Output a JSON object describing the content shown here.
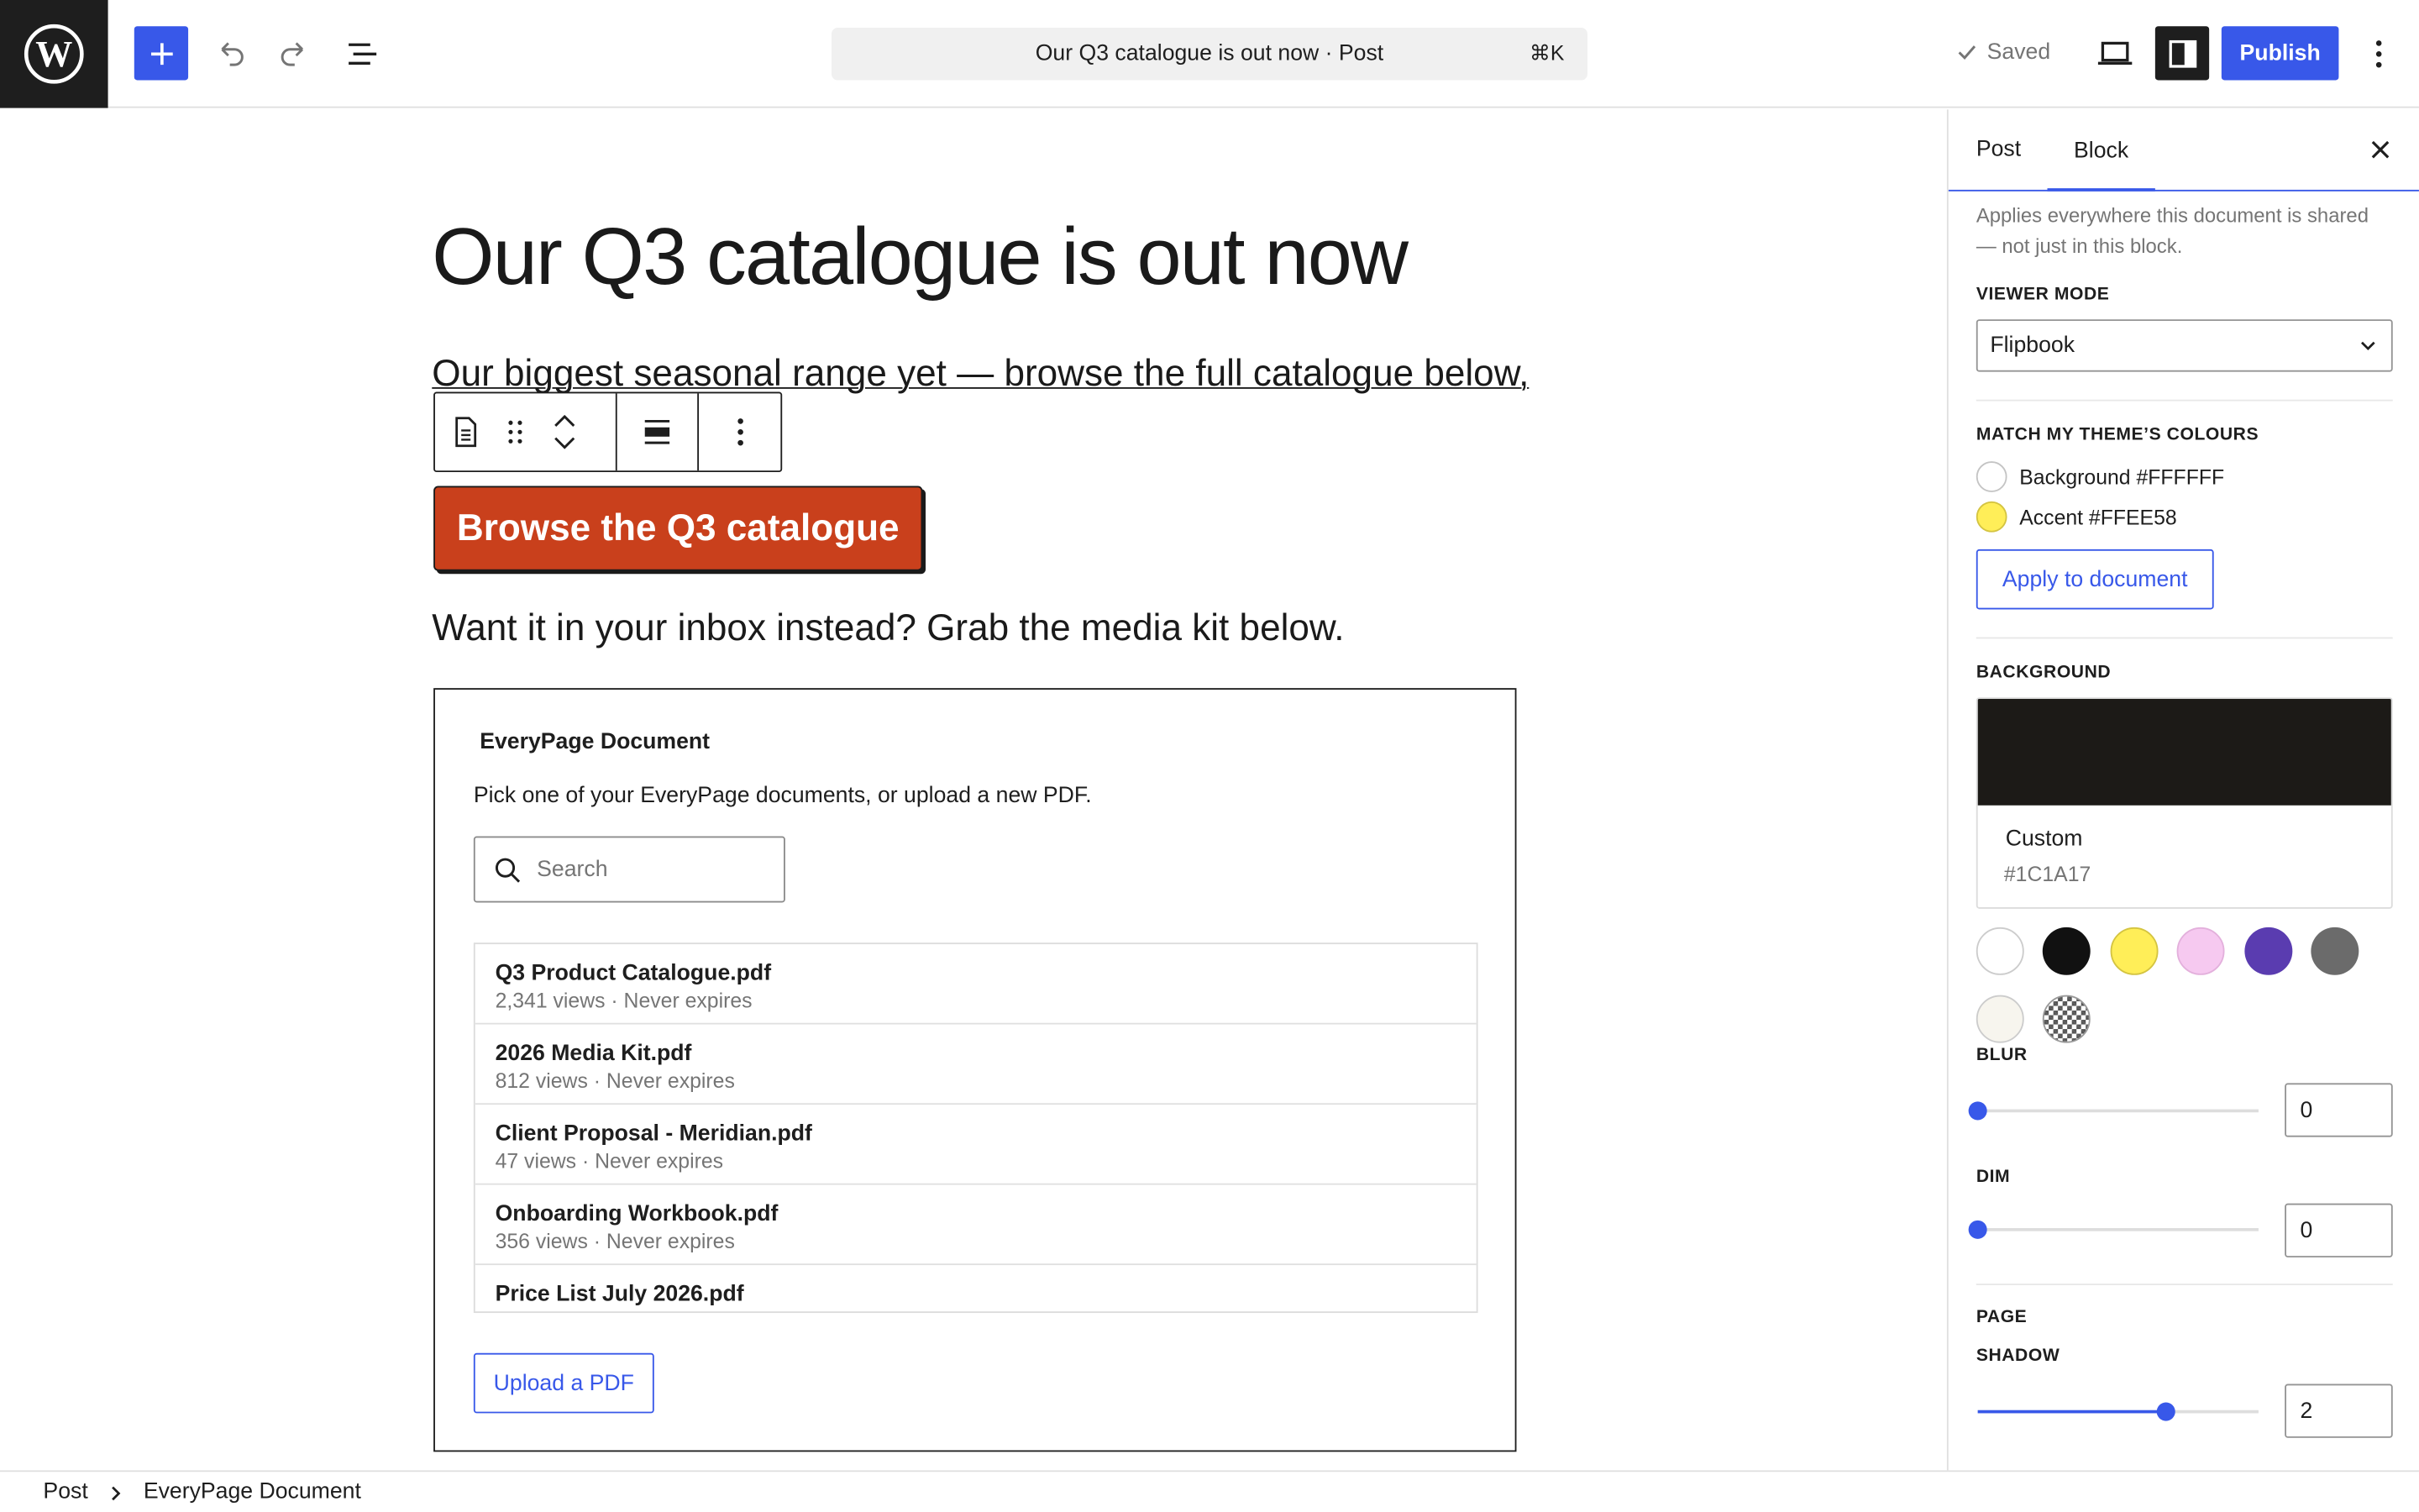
{
  "topbar": {
    "document_title": "Our Q3 catalogue is out now · Post",
    "shortcut": "⌘K",
    "saved_label": "Saved",
    "publish_label": "Publish"
  },
  "post": {
    "title": "Our Q3 catalogue is out now",
    "intro": "Our biggest seasonal range yet — browse the full catalogue below,",
    "cta_label": "Browse the Q3 catalogue",
    "inbox_text": "Want it in your inbox instead? Grab the media kit below."
  },
  "everypage": {
    "title": "EveryPage Document",
    "description": "Pick one of your EveryPage documents, or upload a new PDF.",
    "search_placeholder": "Search",
    "documents": [
      {
        "name": "Q3 Product Catalogue.pdf",
        "meta": "2,341 views · Never expires"
      },
      {
        "name": "2026 Media Kit.pdf",
        "meta": "812 views · Never expires"
      },
      {
        "name": "Client Proposal - Meridian.pdf",
        "meta": "47 views · Never expires"
      },
      {
        "name": "Onboarding Workbook.pdf",
        "meta": "356 views · Never expires"
      },
      {
        "name": "Price List July 2026.pdf",
        "meta": ""
      }
    ],
    "upload_label": "Upload a PDF"
  },
  "sidebar": {
    "tabs": {
      "post": "Post",
      "block": "Block"
    },
    "help_text": "Applies everywhere this document is shared — not just in this block.",
    "viewer_mode_label": "Viewer mode",
    "viewer_mode_value": "Flipbook",
    "match_colours_label": "Match my theme’s colours",
    "theme_colours": [
      {
        "label": "Background #FFFFFF",
        "color": "#FFFFFF"
      },
      {
        "label": "Accent #FFEE58",
        "color": "#FFEE58"
      }
    ],
    "apply_label": "Apply to document",
    "background_label": "Background",
    "background_name": "Custom",
    "background_hex": "#1C1A17",
    "palette": [
      "#FFFFFF",
      "#111111",
      "#FFEE58",
      "#F6C9F0",
      "#5A3CB0",
      "#6B6B6B",
      "#F7F5EE",
      "checkerboard"
    ],
    "blur_label": "Blur",
    "blur_value": "0",
    "dim_label": "Dim",
    "dim_value": "0",
    "page_label": "Page",
    "shadow_label": "Shadow",
    "shadow_value": "2",
    "shadow_fraction": 0.67
  },
  "footer": {
    "crumbs": [
      "Post",
      "EveryPage Document"
    ]
  },
  "colors": {
    "accent": "#3858e9",
    "cta_background": "#c9401c"
  }
}
